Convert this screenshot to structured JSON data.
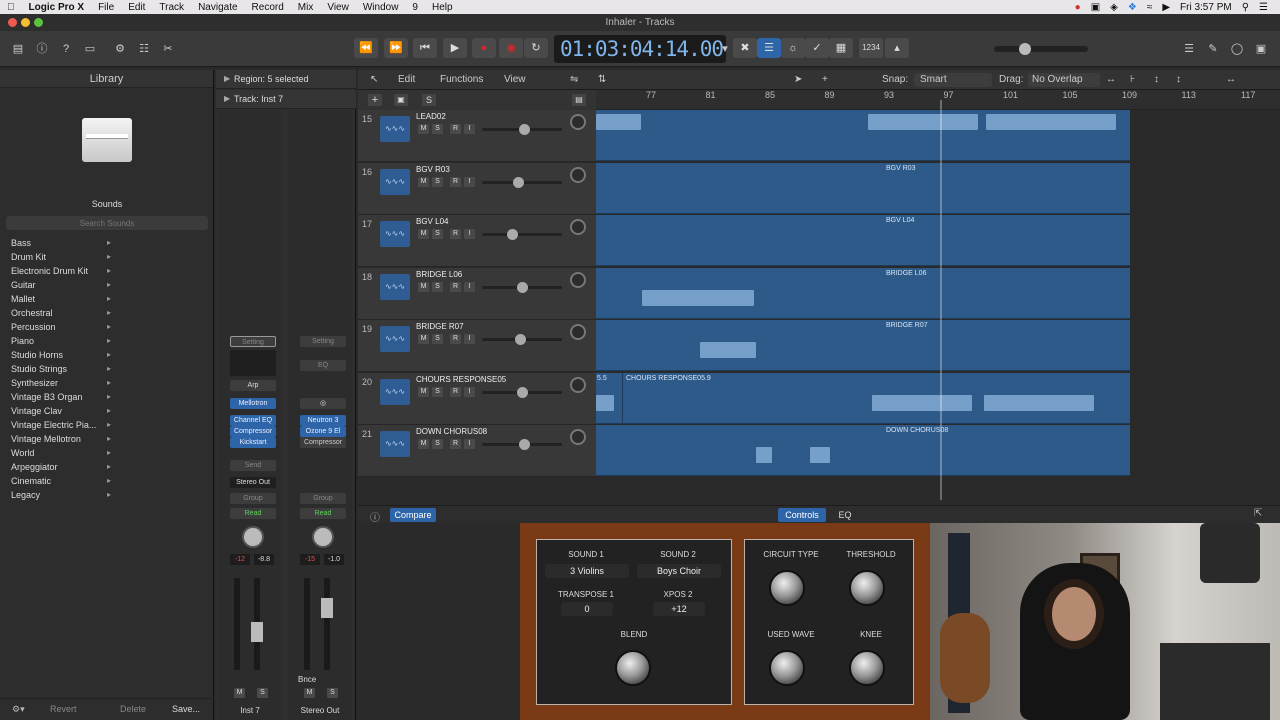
{
  "menubar": {
    "app": "Logic Pro X",
    "items": [
      "File",
      "Edit",
      "Track",
      "Navigate",
      "Record",
      "Mix",
      "View",
      "Window",
      "9",
      "Help"
    ],
    "clock": "Fri 3:57 PM"
  },
  "window": {
    "title": "Inhaler - Tracks"
  },
  "transport": {
    "lcd": "01:03:04:14.00",
    "cpu": "1234"
  },
  "library": {
    "title": "Library",
    "sounds_label": "Sounds",
    "search_placeholder": "Search Sounds",
    "categories": [
      "Bass",
      "Drum Kit",
      "Electronic Drum Kit",
      "Guitar",
      "Mallet",
      "Orchestral",
      "Percussion",
      "Piano",
      "Studio Horns",
      "Studio Strings",
      "Synthesizer",
      "Vintage B3 Organ",
      "Vintage Clav",
      "Vintage Electric Pia...",
      "Vintage Mellotron",
      "World",
      "Arpeggiator",
      "Cinematic",
      "Legacy"
    ],
    "footer": {
      "revert": "Revert",
      "delete": "Delete",
      "save": "Save..."
    }
  },
  "inspector": {
    "region": "Region: 5 selected",
    "track": "Track: Inst 7",
    "strip1": {
      "setting": "Setting",
      "arp": "Arp",
      "instrument": "Mellotron",
      "plugins": [
        "Channel EQ",
        "Compressor",
        "Kickstart"
      ],
      "send": "Send",
      "output": "Stereo Out",
      "group": "Group",
      "automation": "Read",
      "gain1": "-12",
      "gain2": "-8.8",
      "name": "Inst 7",
      "m": "M",
      "s": "S"
    },
    "strip2": {
      "setting": "Setting",
      "eq": "EQ",
      "plugins": [
        "Neutron 3",
        "Ozone 9 El",
        "Compressor"
      ],
      "group": "Group",
      "automation": "Read",
      "gain1": "-15",
      "gain2": "-1.0",
      "bounce": "Bnce",
      "name": "Stereo Out",
      "m": "M",
      "s": "S"
    }
  },
  "tracks_bar": {
    "edit": "Edit",
    "functions": "Functions",
    "view": "View",
    "snap_label": "Snap:",
    "snap_value": "Smart",
    "drag_label": "Drag:",
    "drag_value": "No Overlap"
  },
  "ruler": [
    "77",
    "81",
    "85",
    "89",
    "93",
    "97",
    "101",
    "105",
    "109",
    "113",
    "117"
  ],
  "tracks": [
    {
      "num": "15",
      "name": "LEAD02",
      "region": ""
    },
    {
      "num": "16",
      "name": "BGV R03",
      "region": "BGV R03"
    },
    {
      "num": "17",
      "name": "BGV L04",
      "region": "BGV L04"
    },
    {
      "num": "18",
      "name": "BRIDGE L06",
      "region": "BRIDGE L06"
    },
    {
      "num": "19",
      "name": "BRIDGE R07",
      "region": "BRIDGE R07"
    },
    {
      "num": "20",
      "name": "CHOURS RESPONSE05",
      "region": "CHOURS RESPONSE05.9",
      "region_pre": "5.5"
    },
    {
      "num": "21",
      "name": "DOWN CHORUS08",
      "region": "DOWN CHORUS08"
    }
  ],
  "track_buttons": {
    "m": "M",
    "s": "S",
    "r": "R",
    "i": "I"
  },
  "plugin": {
    "compare": "Compare",
    "controls": "Controls",
    "eq": "EQ",
    "sound1_label": "SOUND 1",
    "sound1_value": "3 Violins",
    "sound2_label": "SOUND 2",
    "sound2_value": "Boys Choir",
    "transpose_label": "TRANSPOSE 1",
    "transpose_value": "0",
    "xpos_label": "XPOS 2",
    "xpos_value": "+12",
    "blend_label": "BLEND",
    "circuit_label": "CIRCUIT TYPE",
    "threshold_label": "THRESHOLD",
    "wave_label": "USED WAVE",
    "knee_label": "KNEE"
  },
  "colors": {
    "accent": "#2e64a8",
    "region": "#2d5a89",
    "record": "#d6262a"
  }
}
